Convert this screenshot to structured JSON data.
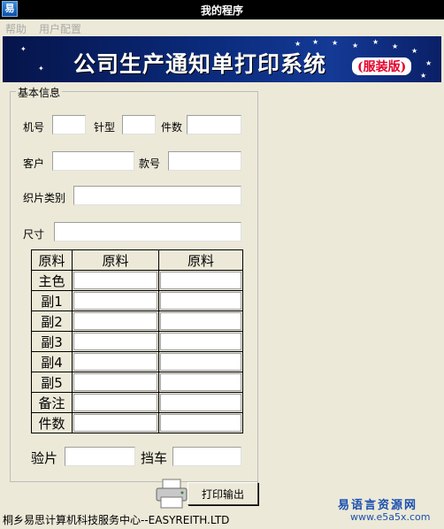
{
  "window": {
    "title": "我的程序"
  },
  "menu": {
    "items": [
      "帮助",
      "用户配置"
    ]
  },
  "banner": {
    "title": "公司生产通知单打印系统",
    "subtitle": "(服装版)"
  },
  "group": {
    "caption": "基本信息"
  },
  "labels": {
    "machine_no": "机号",
    "needle_type": "针型",
    "piece_count": "件数",
    "customer": "客户",
    "style_no": "款号",
    "panel_category": "织片类别",
    "size": "尺寸",
    "sample_check": "验片",
    "stop_car": "挡车"
  },
  "table": {
    "headers": [
      "原料",
      "原料",
      "原料"
    ],
    "rows": [
      "主色",
      "副1",
      "副2",
      "副3",
      "副4",
      "副5",
      "备注",
      "件数"
    ]
  },
  "actions": {
    "print_label": "打印输出"
  },
  "status": {
    "text": "桐乡易思计算机科技服务中心--EASYREITH.LTD"
  },
  "watermark": {
    "cn": "易语言资源网",
    "url": "www.e5a5x.com"
  },
  "colors": {
    "banner_bg": "#0a2a7a",
    "subtitle_red": "#e4002b",
    "window_bg": "#ece9d8"
  }
}
